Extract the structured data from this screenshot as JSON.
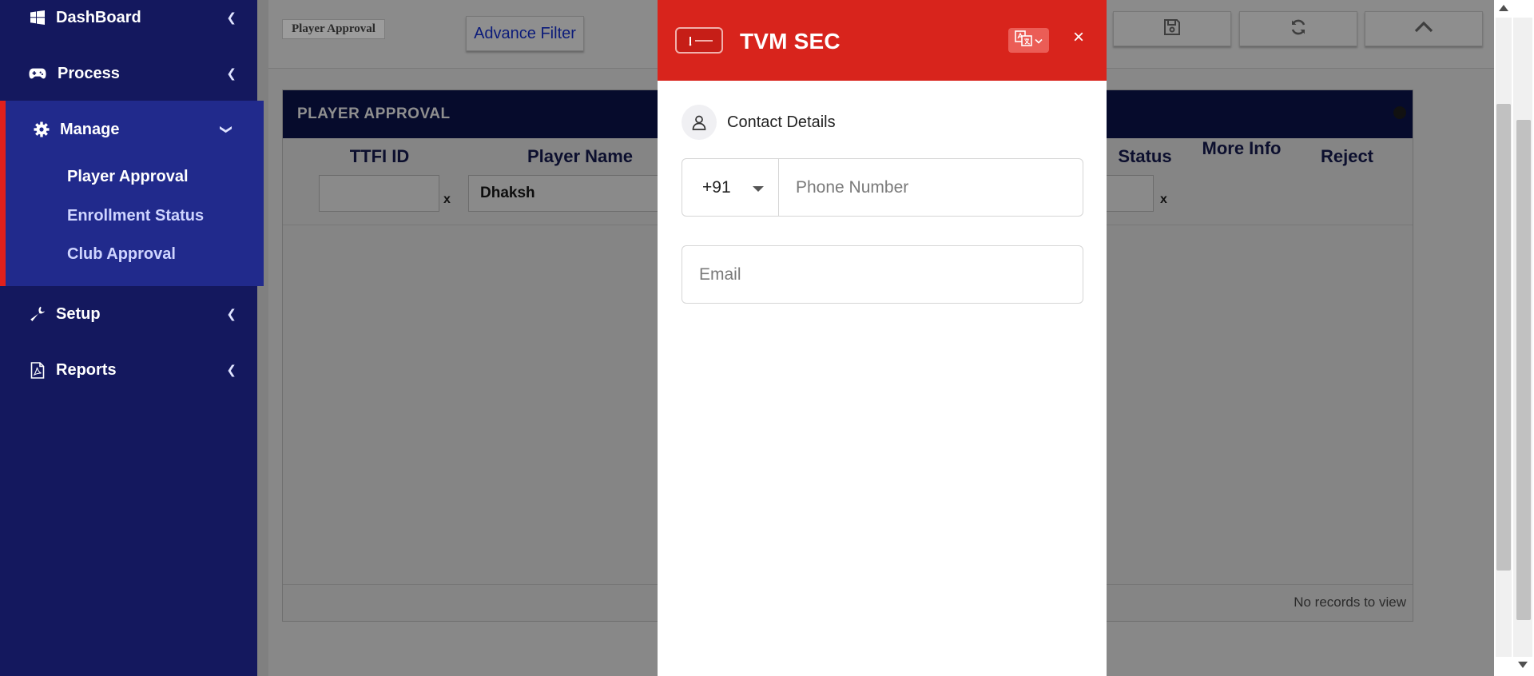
{
  "sidebar": {
    "items": [
      {
        "label": "DashBoard",
        "icon": "windows-icon"
      },
      {
        "label": "Process",
        "icon": "gamepad-icon"
      },
      {
        "label": "Manage",
        "icon": "gear-icon",
        "expanded": true
      },
      {
        "label": "Setup",
        "icon": "wrench-icon"
      },
      {
        "label": "Reports",
        "icon": "file-pdf-icon"
      }
    ],
    "manage_subitems": [
      "Player Approval",
      "Enrollment Status",
      "Club Approval"
    ],
    "active_subitem": "Player Approval",
    "colors": {
      "background": "#14185e",
      "active_block": "#212a8c",
      "active_border": "#e0201c"
    }
  },
  "toolbar": {
    "page_tag": "Player Approval",
    "advance_filter_label": "Advance Filter",
    "buttons": [
      "save-icon",
      "refresh-icon",
      "chevron-up-icon"
    ]
  },
  "grid": {
    "caption": "PLAYER APPROVAL",
    "columns": {
      "ttfi_id": "TTFI ID",
      "player_name": "Player Name",
      "status": "Status",
      "more_info": "More Info",
      "reject": "Reject"
    },
    "filters": {
      "ttfi_id": "",
      "player_name": "Dhaksh",
      "status": "",
      "clear": "x"
    },
    "footer_text": "No records to view"
  },
  "modal": {
    "title": "TVM SEC",
    "header_color": "#d8241c",
    "language_icon": "translate-icon",
    "close_label": "×",
    "section_title": "Contact Details",
    "country_code": "+91",
    "phone_placeholder": "Phone Number",
    "email_placeholder": "Email"
  }
}
